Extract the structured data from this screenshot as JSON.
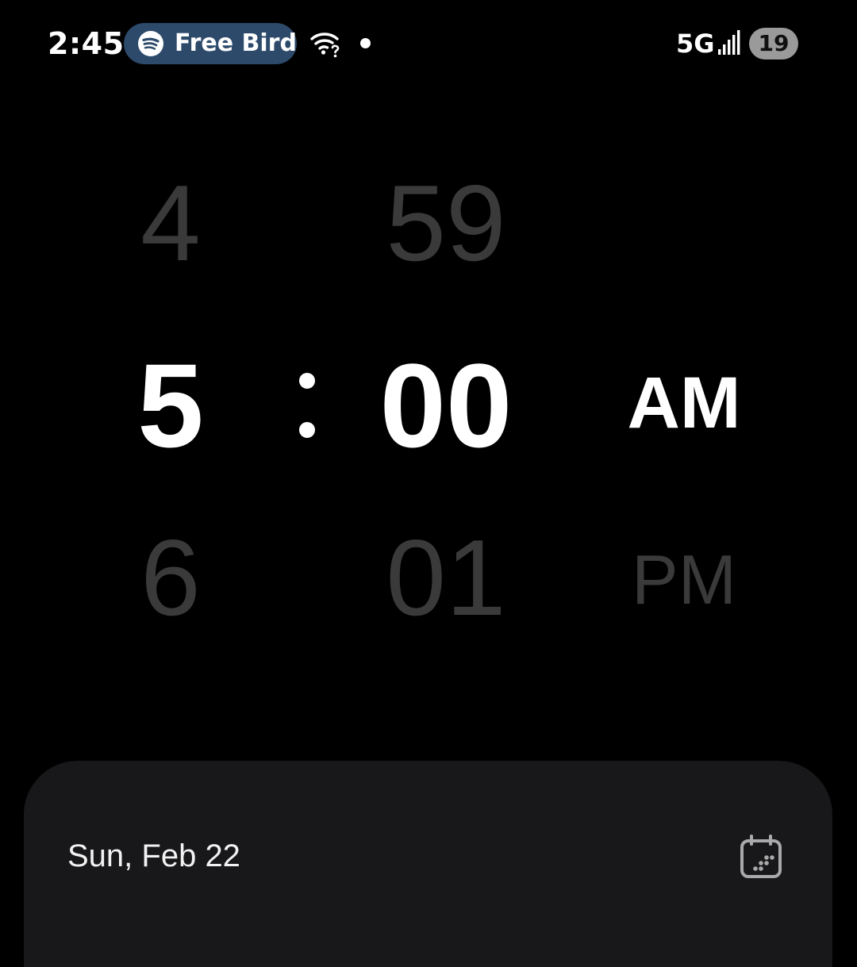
{
  "status_bar": {
    "time": "2:45",
    "media": {
      "app_icon": "spotify-icon",
      "label": "Free Bird"
    },
    "icons": [
      "wifi-icon",
      "notification-dot",
      "signal-icon"
    ],
    "network": "5G",
    "battery": "19"
  },
  "picker": {
    "hour": {
      "prev": "4",
      "selected": "5",
      "next": "6"
    },
    "minute": {
      "prev": "59",
      "selected": "00",
      "next": "01"
    },
    "period": {
      "selected": "AM",
      "next": "PM"
    },
    "separator": ":"
  },
  "sheet": {
    "date": "Sun, Feb 22",
    "calendar_icon": "calendar-icon"
  },
  "colors": {
    "background": "#000000",
    "media_pill": "#2d4a6b",
    "sheet": "#18181a",
    "dim_text": "#3a3a3a",
    "selected_text": "#ffffff",
    "battery_badge": "#9a9a9a"
  }
}
